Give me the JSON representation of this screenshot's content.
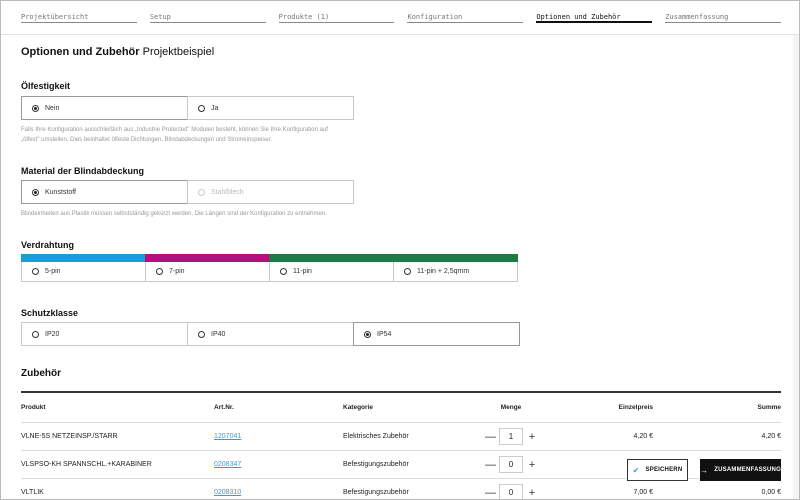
{
  "stepper": {
    "steps": [
      {
        "label": "Projektübersicht",
        "active": false
      },
      {
        "label": "Setup",
        "active": false
      },
      {
        "label": "Produkte (1)",
        "active": false
      },
      {
        "label": "Konfiguration",
        "active": false
      },
      {
        "label": "Optionen und Zubehör",
        "active": true
      },
      {
        "label": "Zusammenfassung",
        "active": false
      }
    ]
  },
  "page": {
    "title": "Optionen und Zubehör",
    "subtitle": "Projektbeispiel"
  },
  "oelfestigkeit": {
    "title": "Ölfestigkeit",
    "options": [
      "Nein",
      "Ja"
    ],
    "selected": "Nein",
    "help_line1": "Falls Ihre Konfiguration ausschließlich aus „Industrie Protected\" Modulen besteht, können Sie Ihre Konfiguration auf",
    "help_line2": "„ölfest\" umstellen. Dies beinhaltet ölfeste Dichtungen, Blindabdeckungen und Stromeinspeiser."
  },
  "material": {
    "title": "Material der Blindabdeckung",
    "options": [
      "Kunststoff",
      "Stahlblech"
    ],
    "selected": "Kunststoff",
    "disabled": "Stahlblech",
    "help": "Blindeinheiten aus Plastik müssen selbstständig gekürzt werden. Die Längen sind der Konfiguration zu entnehmen."
  },
  "verdrahtung": {
    "title": "Verdrahtung",
    "options": [
      {
        "label": "5-pin",
        "color": "#1e9ad6"
      },
      {
        "label": "7-pin",
        "color": "#b0117e"
      },
      {
        "label": "11-pin",
        "color": "#1e7a46"
      },
      {
        "label": "11-pin + 2,5qmm",
        "color": "#1e7a46"
      }
    ],
    "selected": "5-pin"
  },
  "schutzklasse": {
    "title": "Schutzklasse",
    "options": [
      "IP20",
      "IP40",
      "IP54"
    ],
    "selected": "IP54"
  },
  "zubehoer": {
    "title": "Zubehör",
    "headers": {
      "produkt": "Produkt",
      "artnr": "Art.Nr.",
      "kategorie": "Kategorie",
      "menge": "Menge",
      "einzelpreis": "Einzelpreis",
      "summe": "Summe"
    },
    "rows": [
      {
        "produkt": "VLNE-5S NETZEINSP./STARR",
        "artnr": "1207041",
        "kategorie": "Elektrisches Zubehör",
        "menge": "1",
        "einzelpreis": "4,20 €",
        "summe": "4,20 €"
      },
      {
        "produkt": "VLSPSO-KH SPANNSCHL.+KARABINER",
        "artnr": "0208347",
        "kategorie": "Befestigungszubehör",
        "menge": "0",
        "einzelpreis": "",
        "summe": ""
      },
      {
        "produkt": "VLTLIK",
        "artnr": "0208310",
        "kategorie": "Befestigungszubehör",
        "menge": "0",
        "einzelpreis": "7,00 €",
        "summe": "0,00 €"
      }
    ],
    "minus": "—",
    "plus": "+"
  },
  "actions": {
    "save": "SPEICHERN",
    "summary": "ZUSAMMENFASSUNG"
  }
}
